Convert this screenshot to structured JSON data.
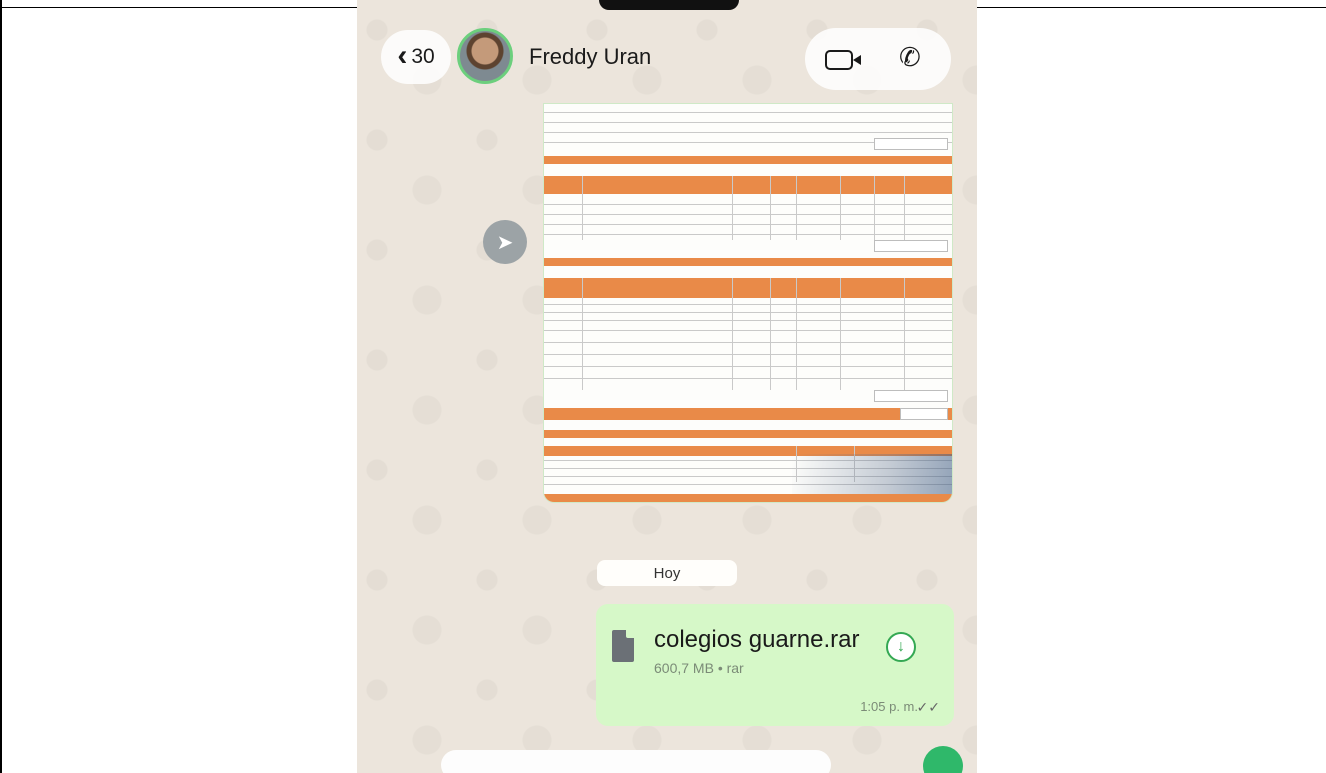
{
  "header": {
    "back_count": "30",
    "back_icon": "chevron-left-icon",
    "contact_name": "Freddy Uran",
    "video_icon": "video-camera-icon",
    "phone_icon": "phone-icon"
  },
  "conversation": {
    "forward_icon": "forward-arrow-icon",
    "date_divider": "Hoy",
    "file_message": {
      "file_name": "colegios guarne.rar",
      "file_meta": "600,7 MB • rar",
      "time": "1:05 p. m.",
      "ticks": "✓✓",
      "download_icon": "download-arrow-icon"
    }
  },
  "colors": {
    "chat_background": "#ece5dc",
    "outgoing_bubble": "#d6f8c8",
    "accent_green": "#34a853",
    "document_band": "#e98a48"
  }
}
